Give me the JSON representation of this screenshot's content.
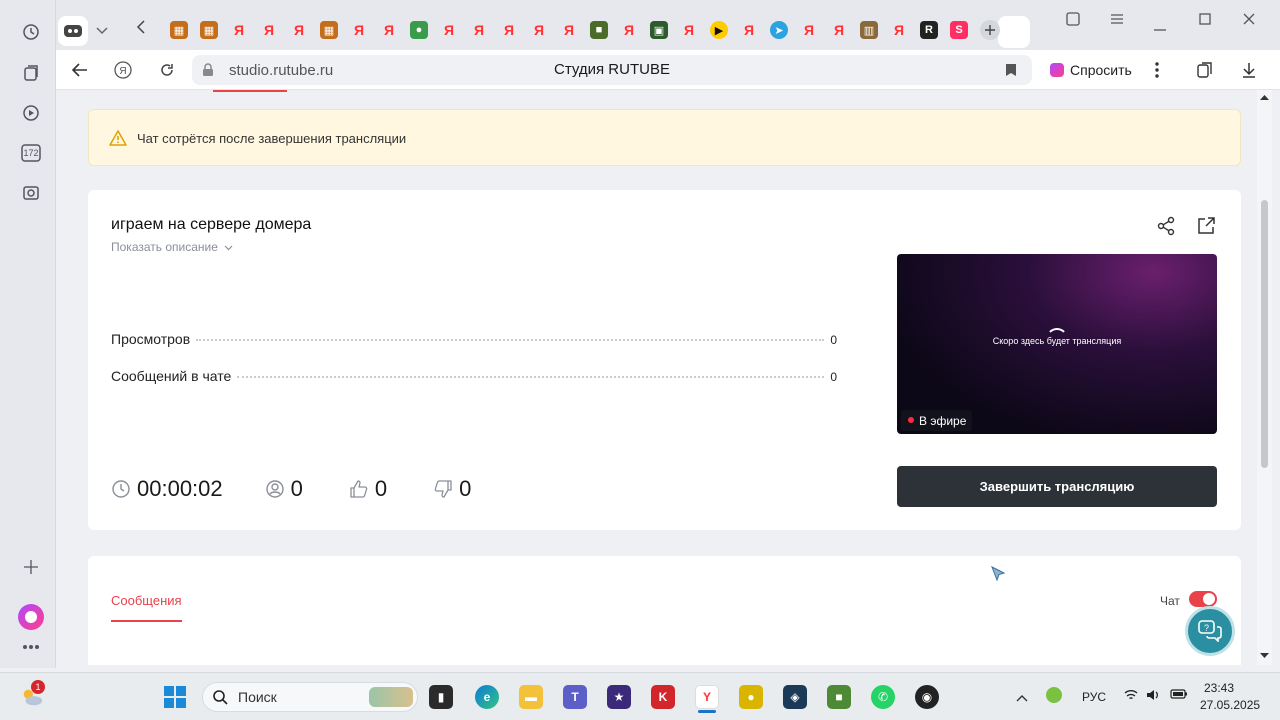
{
  "browser": {
    "url": "studio.rutube.ru",
    "page_title": "Студия RUTUBE",
    "ask_label": "Спросить",
    "sidebar_counter": "172"
  },
  "alert": {
    "text": "Чат сотрётся после завершения трансляции"
  },
  "stream": {
    "title": "играем на сервере домера",
    "show_description": "Показать описание",
    "stats": [
      {
        "label": "Просмотров",
        "value": "0"
      },
      {
        "label": "Сообщений в чате",
        "value": "0"
      }
    ],
    "duration": "00:00:02",
    "viewers": "0",
    "likes": "0",
    "dislikes": "0",
    "preview_text": "Скоро здесь будет трансляция",
    "live_badge": "В эфире",
    "end_button": "Завершить трансляцию"
  },
  "chat_panel": {
    "tab_messages": "Сообщения",
    "chat_toggle_label": "Чат",
    "chat_enabled": true
  },
  "taskbar": {
    "search_placeholder": "Поиск",
    "notification_count": "1",
    "language": "РУС",
    "time": "23:43",
    "date": "27.05.2025"
  },
  "colors": {
    "accent_red": "#e8424b",
    "dark_button": "#2d3238",
    "alert_bg": "#fff7e0",
    "support_teal": "#2a8fa0"
  }
}
